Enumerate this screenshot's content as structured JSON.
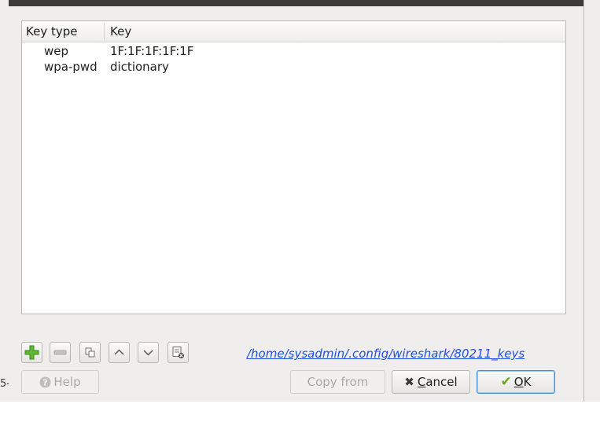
{
  "partial_left_text": "5-",
  "table": {
    "headers": {
      "key_type": "Key type",
      "key": "Key"
    },
    "rows": [
      {
        "key_type": "wep",
        "key": "1F:1F:1F:1F:1F"
      },
      {
        "key_type": "wpa-pwd",
        "key": "dictionary"
      }
    ]
  },
  "toolbar": {
    "icons": [
      "add-icon",
      "remove-icon",
      "copy-icon",
      "move-up-icon",
      "move-down-icon",
      "clear-icon"
    ],
    "file_path": "/home/sysadmin/.config/wireshark/80211_keys"
  },
  "buttons": {
    "help": "Help",
    "copy_from": "Copy from",
    "cancel_prefix": "",
    "cancel_mnemonic": "C",
    "cancel_rest": "ancel",
    "ok_mnemonic": "O",
    "ok_rest": "K"
  },
  "colors": {
    "link": "#1f4fe0",
    "add_green": "#5fb832",
    "ok_check": "#6aa41f",
    "cancel_x": "#3c3b37"
  }
}
